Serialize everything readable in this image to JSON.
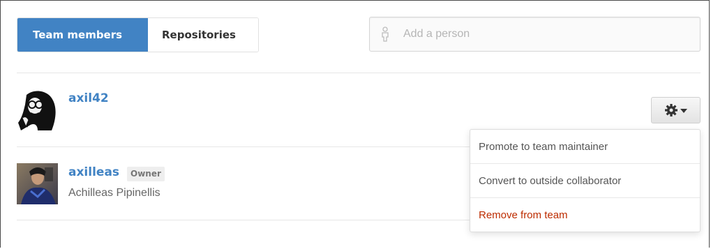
{
  "tabs": [
    {
      "label": "Team members",
      "selected": true
    },
    {
      "label": "Repositories",
      "selected": false
    }
  ],
  "add_person": {
    "placeholder": "Add a person",
    "icon": "person-icon"
  },
  "members": [
    {
      "username": "axil42",
      "full_name": "",
      "badge": ""
    },
    {
      "username": "axilleas",
      "full_name": "Achilleas Pipinellis",
      "badge": "Owner"
    }
  ],
  "member_menu": {
    "icon": "gear-icon",
    "items": [
      {
        "label": "Promote to team maintainer"
      },
      {
        "label": "Convert to outside collaborator"
      },
      {
        "label": "Remove from team",
        "danger": true
      }
    ]
  },
  "colors": {
    "accent": "#4183c4",
    "danger": "#bd2c00",
    "badge_bg": "#eeeeee"
  }
}
